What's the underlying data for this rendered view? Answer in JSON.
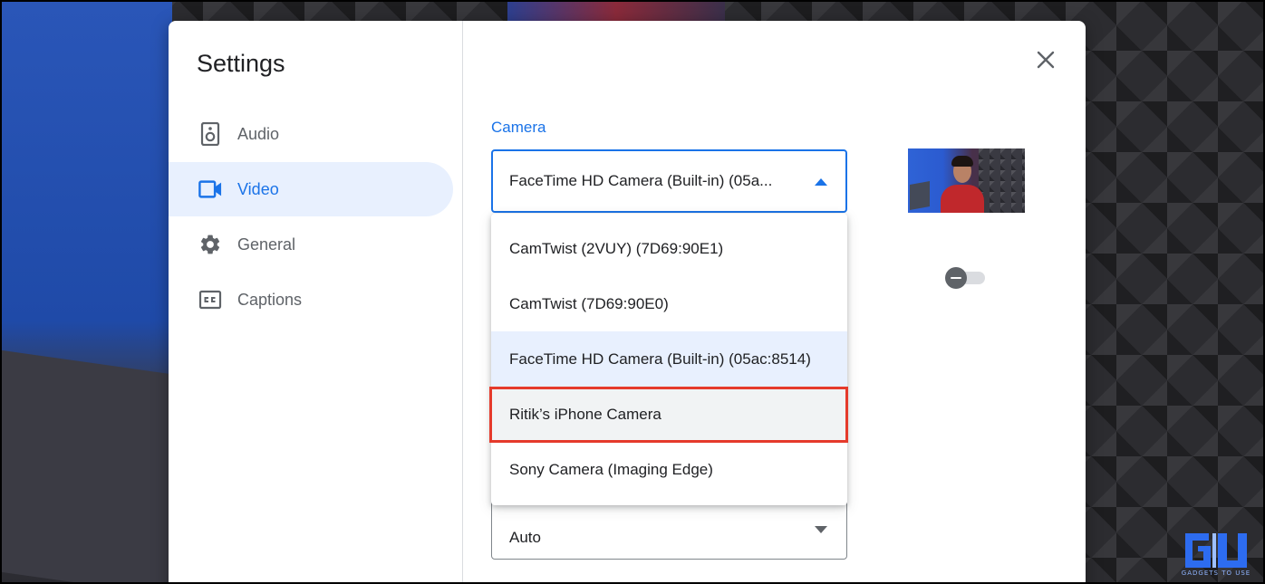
{
  "dialog": {
    "title": "Settings",
    "close_icon": "close-icon"
  },
  "sidebar": {
    "items": [
      {
        "label": "Audio",
        "icon": "speaker-icon",
        "active": false
      },
      {
        "label": "Video",
        "icon": "videocam-icon",
        "active": true
      },
      {
        "label": "General",
        "icon": "gear-icon",
        "active": false
      },
      {
        "label": "Captions",
        "icon": "closed-captions-icon",
        "active": false
      }
    ]
  },
  "camera": {
    "label": "Camera",
    "selected_value": "FaceTime HD Camera (Built-in) (05a...",
    "options": [
      "CamTwist (2VUY) (7D69:90E1)",
      "CamTwist (7D69:90E0)",
      "FaceTime HD Camera (Built-in) (05ac:8514)",
      "Ritik’s iPhone Camera",
      "Sony Camera (Imaging Edge)"
    ],
    "selected_index": 2,
    "highlighted_index": 3
  },
  "resolution": {
    "value": "Auto"
  },
  "colors": {
    "accent": "#1a73e8",
    "active_nav_bg": "#e8f0fe",
    "highlight_outline": "#e53a2b"
  },
  "watermark": {
    "text": "GADGETS TO USE"
  }
}
